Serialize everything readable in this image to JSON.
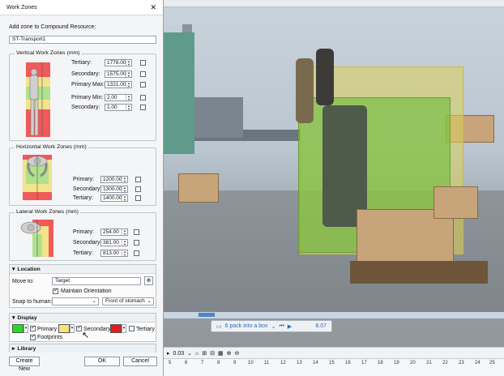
{
  "dialog": {
    "title": "Work Zones",
    "add_zone_label": "Add zone to Compound Resource:",
    "resource_value": "ST-Transport1",
    "vertical": {
      "title": "Vertical Work Zones (mm)",
      "rows": [
        {
          "label": "Tertiary:",
          "value": "1778.00"
        },
        {
          "label": "Secondary:",
          "value": "1575.00"
        },
        {
          "label": "Primary Max:",
          "value": "1321.00"
        },
        {
          "label": "Primary Min:",
          "value": "2.00"
        },
        {
          "label": "Secondary:",
          "value": "1.00"
        }
      ]
    },
    "horizontal": {
      "title": "Horizontal Work Zones (mm)",
      "rows": [
        {
          "label": "Primary:",
          "value": "1200.00"
        },
        {
          "label": "Secondary:",
          "value": "1300.00"
        },
        {
          "label": "Tertiary:",
          "value": "1400.00"
        }
      ]
    },
    "lateral": {
      "title": "Lateral Work Zones (mm)",
      "rows": [
        {
          "label": "Primary:",
          "value": "254.00"
        },
        {
          "label": "Secondary:",
          "value": "381.00"
        },
        {
          "label": "Tertiary:",
          "value": "813.00"
        }
      ]
    },
    "location": {
      "title": "Location",
      "move_to_label": "Move to:",
      "move_to_value": "Target",
      "maintain_orientation": "Maintain Orientation",
      "snap_label": "Snap to human:",
      "snap_value": "",
      "snap_option": "Front of stomach"
    },
    "display": {
      "title": "Display",
      "primary_label": "Primary",
      "secondary_label": "Secondary",
      "tertiary_label": "Tertiary",
      "footprints_label": "Footprints",
      "primary_color": "#22dd22",
      "secondary_color": "#f6e27a",
      "tertiary_color": "#e21b1b"
    },
    "library": {
      "title": "Library"
    },
    "buttons": {
      "create_new": "Create New",
      "ok": "OK",
      "cancel": "Cancel"
    }
  },
  "playback": {
    "sequence": "6 pack into a box",
    "time": "8.07"
  },
  "bottom_toolbar": {
    "speed": "0.03"
  },
  "ruler_ticks": [
    "5",
    "6",
    "7",
    "8",
    "9",
    "10",
    "11",
    "12",
    "13",
    "14",
    "15",
    "16",
    "17",
    "18",
    "19",
    "20",
    "21",
    "22",
    "23",
    "24",
    "25"
  ]
}
